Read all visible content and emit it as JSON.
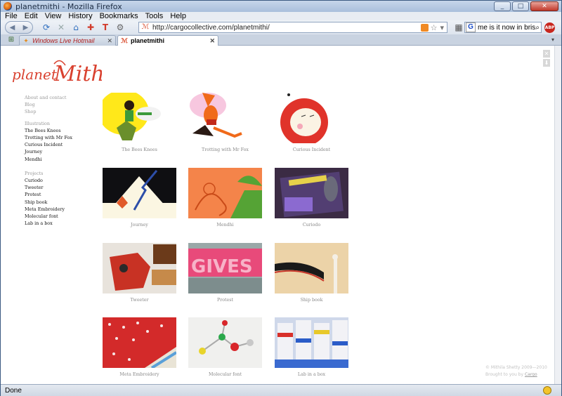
{
  "window": {
    "title": "planetmithi - Mozilla Firefox"
  },
  "menu": [
    "File",
    "Edit",
    "View",
    "History",
    "Bookmarks",
    "Tools",
    "Help"
  ],
  "toolbar": {
    "url": "http://cargocollective.com/planetmithi/",
    "search_query": "me is it now in brisbane?",
    "search_engine_icon": "google-icon",
    "adblock_label": "ABP"
  },
  "tabs": [
    {
      "label": "Windows Live Hotmail",
      "active": false
    },
    {
      "label": "planetmithi",
      "active": true
    }
  ],
  "site": {
    "logo_text": "planetMithi",
    "nav_top": [
      "About and contact",
      "Blog",
      "Shop"
    ],
    "illustration_header": "Illustration",
    "illustration_items": [
      "The Bees Knees",
      "Trotting with Mr Fox",
      "Curious Incident",
      "Journey",
      "Mendhi"
    ],
    "projects_header": "Projects",
    "projects_items": [
      "Curiodo",
      "Tweeter",
      "Protest",
      "Ship book",
      "Meta Embroidery",
      "Molecular font",
      "Lab in a box"
    ],
    "thumbnails": [
      {
        "caption": "The Bees Knees"
      },
      {
        "caption": "Trotting with Mr Fox"
      },
      {
        "caption": "Curious Incident"
      },
      {
        "caption": "Journey"
      },
      {
        "caption": "Mendhi"
      },
      {
        "caption": "Curiodo"
      },
      {
        "caption": "Tweeter"
      },
      {
        "caption": "Protest"
      },
      {
        "caption": "Ship book"
      },
      {
        "caption": "Meta Embroidery"
      },
      {
        "caption": "Molecular font"
      },
      {
        "caption": "Lab in a box"
      }
    ],
    "footer_copyright": "© Mithila Shetty 2009—2010",
    "footer_brought": "Brought to you by",
    "footer_link": "Cargo"
  },
  "status": {
    "text": "Done"
  }
}
